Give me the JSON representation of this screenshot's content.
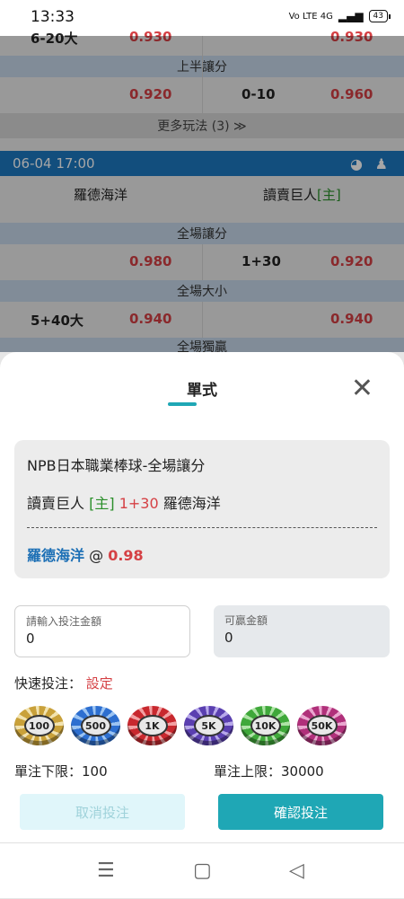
{
  "status": {
    "time": "13:33",
    "network": "Vo LTE 4G",
    "battery": "43"
  },
  "list": {
    "top_partial": {
      "label": "6-20大",
      "left_odds": "0.930",
      "right_odds": "0.930"
    },
    "half_handicap": {
      "header": "上半讓分",
      "left_odds": "0.920",
      "line": "0-10",
      "right_odds": "0.960"
    },
    "more": "更多玩法 (3) ≫",
    "game": {
      "datetime": "06-04 17:00",
      "away": "羅德海洋",
      "home": "讀賣巨人",
      "home_tag": "[主]"
    },
    "full_handicap": {
      "header": "全場讓分",
      "left_odds": "0.980",
      "line": "1+30",
      "right_odds": "0.920"
    },
    "full_total": {
      "header": "全場大小",
      "label": "5+40大",
      "left_odds": "0.940",
      "right_odds": "0.940"
    },
    "next_header": "全場獨贏"
  },
  "sheet": {
    "tab": "單式",
    "bet": {
      "league": "NPB日本職業棒球-全場讓分",
      "home": "讀賣巨人",
      "home_tag": "[主]",
      "line": "1+30",
      "away": "羅德海洋",
      "selection": "羅德海洋",
      "at": "@",
      "odds": "0.98"
    },
    "stake": {
      "label": "請輸入投注金額",
      "value": "0"
    },
    "win": {
      "label": "可贏金額",
      "value": "0"
    },
    "quick": {
      "label": "快速投注：",
      "setting": "設定"
    },
    "chips": [
      {
        "label": "100",
        "color": "#c9a13a"
      },
      {
        "label": "500",
        "color": "#2d6fd0"
      },
      {
        "label": "1K",
        "color": "#c8282e"
      },
      {
        "label": "5K",
        "color": "#5a3fb0"
      },
      {
        "label": "10K",
        "color": "#3fa83a"
      },
      {
        "label": "50K",
        "color": "#b0307a"
      }
    ],
    "min_limit": "單注下限：100",
    "max_limit": "單注上限：30000",
    "cancel": "取消投注",
    "confirm": "確認投注"
  },
  "colors": {
    "accent": "#1fa7b5",
    "odds_red": "#d54044",
    "header_blue": "#1c78c0"
  }
}
